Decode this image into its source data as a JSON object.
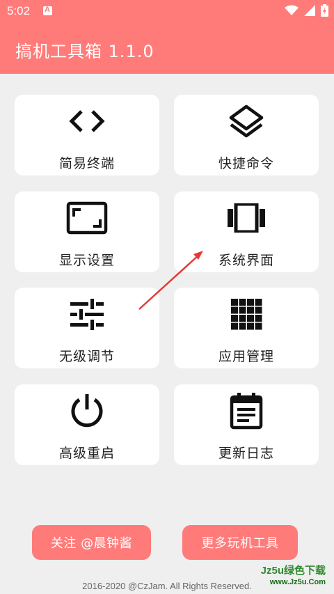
{
  "status_bar": {
    "time": "5:02",
    "icons": [
      "notification-a-icon",
      "wifi-icon",
      "cell-signal-icon",
      "battery-charging-icon"
    ]
  },
  "app_bar": {
    "title": "搞机工具箱 1.1.0",
    "color": "#ff7b79"
  },
  "grid": {
    "items": [
      {
        "label": "简易终端",
        "icon": "code-icon"
      },
      {
        "label": "快捷命令",
        "icon": "layers-icon"
      },
      {
        "label": "显示设置",
        "icon": "aspect-ratio-icon"
      },
      {
        "label": "系统界面",
        "icon": "view-carousel-icon"
      },
      {
        "label": "无级调节",
        "icon": "tune-icon"
      },
      {
        "label": "应用管理",
        "icon": "apps-grid-icon"
      },
      {
        "label": "高级重启",
        "icon": "power-icon"
      },
      {
        "label": "更新日志",
        "icon": "event-note-icon"
      }
    ]
  },
  "buttons": {
    "follow_label": "关注 @晨钟酱",
    "more_label": "更多玩机工具"
  },
  "footer": {
    "copyright": "2016-2020 @CzJam. All Rights Reserved."
  },
  "watermark": {
    "main": "Jz5u绿色下载",
    "sub": "www.Jz5u.Com"
  },
  "colors": {
    "accent": "#ff7b79",
    "background": "#efefef",
    "card": "#ffffff",
    "annotation_arrow": "#e53935"
  }
}
